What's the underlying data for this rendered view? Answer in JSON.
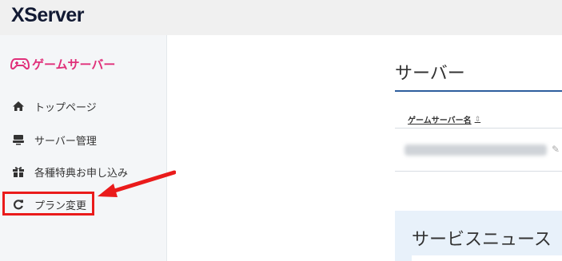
{
  "app": {
    "logo": "XServer"
  },
  "sidebar": {
    "brand": {
      "label": "ゲームサーバー",
      "icon": "gamepad-icon",
      "color": "#e0307a"
    },
    "items": [
      {
        "label": "トップページ",
        "icon": "home-icon"
      },
      {
        "label": "サーバー管理",
        "icon": "server-icon"
      },
      {
        "label": "各種特典お申し込み",
        "icon": "gift-icon"
      },
      {
        "label": "プラン変更",
        "icon": "refresh-icon",
        "highlighted": true
      }
    ]
  },
  "main": {
    "title": "サーバー",
    "table": {
      "column_header": "ゲームサーバー名"
    },
    "news": {
      "title": "サービスニュース"
    }
  },
  "colors": {
    "accent_rule": "#2e5e9e",
    "annotation_red": "#ea1b1b",
    "news_panel_bg": "#e8f1fa",
    "sidebar_bg": "#f4f6f8",
    "topbar_bg": "#f0f0f0"
  }
}
